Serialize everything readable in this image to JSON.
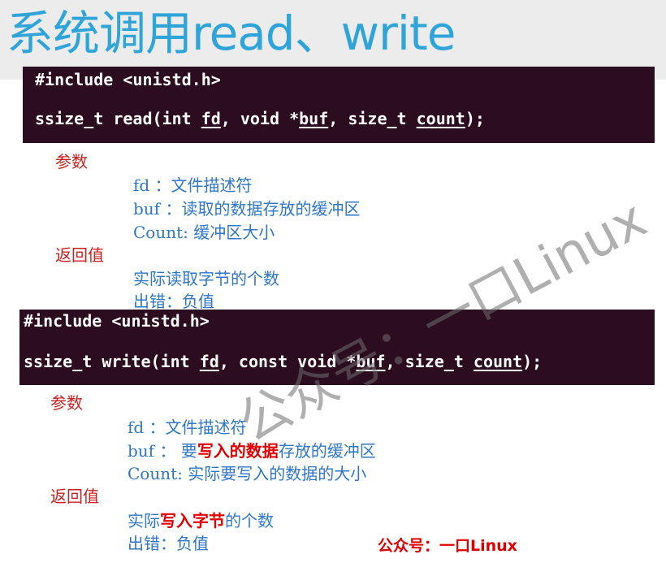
{
  "title": "系统调用read、write",
  "read_section": {
    "code_line1": "#include <unistd.h>",
    "code_line2": {
      "prefix": "ssize_t read(int ",
      "fd": "fd",
      "mid1": ", void *",
      "buf": "buf",
      "mid2": ", size_t ",
      "count": "count",
      "suffix": ");"
    },
    "params_label": "参数",
    "param_fd": "fd  ：文件描述符",
    "param_buf": "buf ：读取的数据存放的缓冲区",
    "param_count": "Count: 缓冲区大小",
    "return_label": "返回值",
    "return_ok": "实际读取字节的个数",
    "return_err": "出错：负值"
  },
  "write_section": {
    "code_line1": "#include <unistd.h>",
    "code_line2": {
      "prefix": "ssize_t write(int ",
      "fd": "fd",
      "mid1": ", const void *",
      "buf": "buf",
      "mid2": ", size_t ",
      "count": "count",
      "suffix": ");"
    },
    "params_label": "参数",
    "param_fd": "fd  ：文件描述符",
    "param_buf_pre": "buf ： 要",
    "param_buf_hl": "写入的数据",
    "param_buf_post": "存放的缓冲区",
    "param_count": "Count: 实际要写入的数据的大小",
    "return_label": "返回值",
    "return_ok_pre": "实际",
    "return_ok_hl": "写入字节",
    "return_ok_post": "的个数",
    "return_err": "出错：负值"
  },
  "footer": "公众号：一口Linux",
  "watermark": "公众号：一口Linux",
  "colors": {
    "title": "#2fa4d9",
    "code_bg": "#2c0d1f",
    "label_red": "#cc1f1f",
    "text_blue": "#2e76c7",
    "highlight": "#e00000"
  }
}
